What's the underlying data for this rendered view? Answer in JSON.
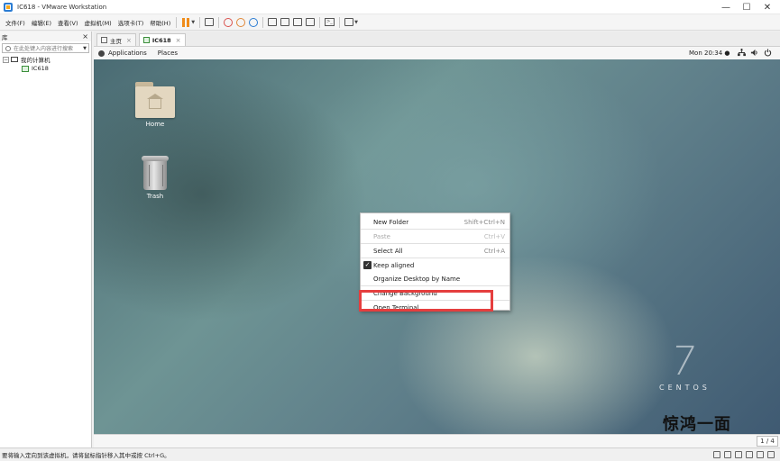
{
  "window": {
    "title": "IC618 - VMware Workstation",
    "controls": [
      "—",
      "☐",
      "✕"
    ]
  },
  "menubar": {
    "items": [
      "文件(F)",
      "编辑(E)",
      "查看(V)",
      "虚拟机(M)",
      "选项卡(T)",
      "帮助(H)"
    ]
  },
  "library": {
    "title": "库",
    "close": "×",
    "search_placeholder": "在此处键入内容进行搜索",
    "tree": {
      "root_label": "我的计算机",
      "root_toggle": "−",
      "vm_label": "IC618"
    }
  },
  "tabs": [
    {
      "label": "主页",
      "close": "×"
    },
    {
      "label": "IC618",
      "close": "×"
    }
  ],
  "guest": {
    "topbar": {
      "applications": "Applications",
      "places": "Places",
      "clock": "Mon 20:34 ●"
    },
    "desktop_icons": {
      "home": "Home",
      "trash": "Trash"
    },
    "context_menu": {
      "items": [
        {
          "label": "New Folder",
          "shortcut": "Shift+Ctrl+N",
          "enabled": true
        },
        {
          "label": "Paste",
          "shortcut": "Ctrl+V",
          "enabled": false
        },
        {
          "label": "Select All",
          "shortcut": "Ctrl+A",
          "enabled": true
        },
        {
          "label": "Keep aligned",
          "shortcut": "",
          "enabled": true,
          "checked": true
        },
        {
          "label": "Organize Desktop by Name",
          "shortcut": "",
          "enabled": true
        },
        {
          "label": "Change Background",
          "shortcut": "",
          "enabled": true
        },
        {
          "label": "Open Terminal",
          "shortcut": "",
          "enabled": true
        }
      ],
      "highlight_color": "#e53e3e"
    },
    "logo": {
      "number": "7",
      "word": "CENTOS"
    },
    "workspace_indicator": "1 / 4"
  },
  "watermark": "惊鸿一面",
  "statusbar": {
    "message": "要将输入定向到该虚拟机，请将鼠标指针移入其中或按 Ctrl+G。"
  },
  "colors": {
    "pause_accent": "#f08c1b",
    "vmware_blue": "#2b7cd3",
    "highlight": "#e53e3e"
  }
}
